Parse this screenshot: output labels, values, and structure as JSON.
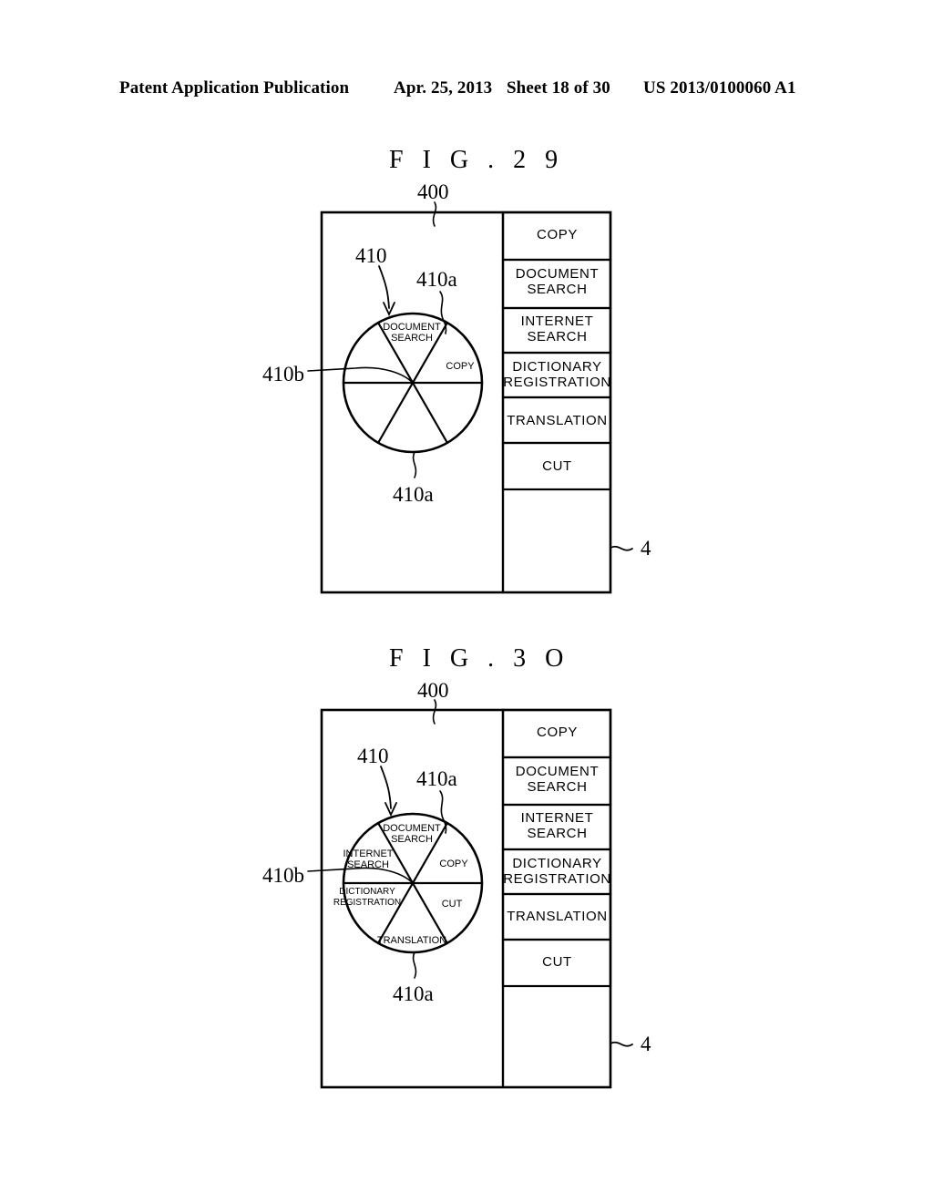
{
  "header": {
    "publication": "Patent Application Publication",
    "date": "Apr. 25, 2013",
    "sheet": "Sheet 18 of 30",
    "patent_number": "US 2013/0100060 A1"
  },
  "figures": [
    {
      "title": "F I G .   2 9",
      "screen_ref": "400",
      "device_ref": "4",
      "pie_ref": "410",
      "sector_ref": "410a",
      "sector_ref_bottom": "410a",
      "center_ref": "410b",
      "menu": {
        "items": [
          "COPY",
          "DOCUMENT\nSEARCH",
          "INTERNET\nSEARCH",
          "DICTIONARY\nREGISTRATION",
          "TRANSLATION",
          "CUT"
        ]
      },
      "pie": {
        "sectors": [
          {
            "label": "DOCUMENT\nSEARCH",
            "position": "top"
          },
          {
            "label": "COPY",
            "position": "upper-right"
          },
          {
            "label": "",
            "position": "lower-right"
          },
          {
            "label": "",
            "position": "bottom"
          },
          {
            "label": "",
            "position": "lower-left"
          },
          {
            "label": "",
            "position": "upper-left"
          }
        ]
      }
    },
    {
      "title": "F I G .   3 O",
      "screen_ref": "400",
      "device_ref": "4",
      "pie_ref": "410",
      "sector_ref": "410a",
      "sector_ref_bottom": "410a",
      "center_ref": "410b",
      "menu": {
        "items": [
          "COPY",
          "DOCUMENT\nSEARCH",
          "INTERNET\nSEARCH",
          "DICTIONARY\nREGISTRATION",
          "TRANSLATION",
          "CUT"
        ]
      },
      "pie": {
        "sectors": [
          {
            "label": "DOCUMENT\nSEARCH",
            "position": "top"
          },
          {
            "label": "COPY",
            "position": "upper-right"
          },
          {
            "label": "CUT",
            "position": "lower-right"
          },
          {
            "label": "TRANSLATION",
            "position": "bottom"
          },
          {
            "label": "DICTIONARY\nREGISTRATION",
            "position": "lower-left"
          },
          {
            "label": "INTERNET\nSEARCH",
            "position": "upper-left"
          }
        ]
      }
    }
  ]
}
